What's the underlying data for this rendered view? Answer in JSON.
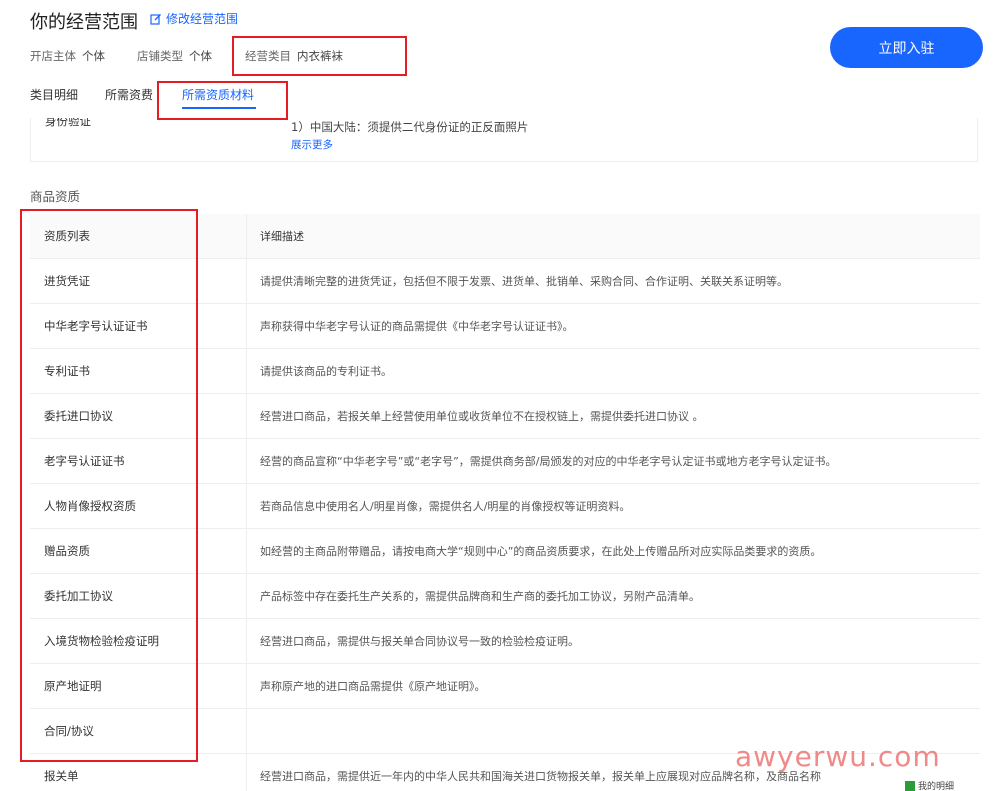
{
  "header": {
    "title": "你的经营范围",
    "edit_label": "修改经营范围",
    "shop_subject_label": "开店主体",
    "shop_subject_value": "个体",
    "shop_type_label": "店铺类型",
    "shop_type_value": "个体",
    "category_label": "经营类目",
    "category_value": "内衣裤袜",
    "cta_label": "立即入驻"
  },
  "tabs": [
    {
      "label": "类目明细"
    },
    {
      "label": "所需资费"
    },
    {
      "label": "所需资质材料",
      "active": true
    }
  ],
  "id_card": {
    "label": "身份验证",
    "text": "1）中国大陆：须提供二代身份证的正反面照片",
    "show_more": "展示更多"
  },
  "section_title": "商品资质",
  "table": {
    "headers": [
      "资质列表",
      "详细描述"
    ],
    "rows": [
      {
        "name": "进货凭证",
        "desc": "请提供清晰完整的进货凭证，包括但不限于发票、进货单、批销单、采购合同、合作证明、关联关系证明等。"
      },
      {
        "name": "中华老字号认证证书",
        "desc": "声称获得中华老字号认证的商品需提供《中华老字号认证证书》。"
      },
      {
        "name": "专利证书",
        "desc": "请提供该商品的专利证书。"
      },
      {
        "name": "委托进口协议",
        "desc": "经营进口商品，若报关单上经营使用单位或收货单位不在授权链上，需提供委托进口协议 。"
      },
      {
        "name": "老字号认证证书",
        "desc": "经营的商品宣称“中华老字号”或“老字号”，需提供商务部/局颁发的对应的中华老字号认定证书或地方老字号认定证书。"
      },
      {
        "name": "人物肖像授权资质",
        "desc": "若商品信息中使用名人/明星肖像，需提供名人/明星的肖像授权等证明资料。"
      },
      {
        "name": "赠品资质",
        "desc": "如经营的主商品附带赠品，请按电商大学“规则中心”的商品资质要求，在此处上传赠品所对应实际品类要求的资质。"
      },
      {
        "name": "委托加工协议",
        "desc": "产品标签中存在委托生产关系的，需提供品牌商和生产商的委托加工协议，另附产品清单。"
      },
      {
        "name": "入境货物检验检疫证明",
        "desc": "经营进口商品，需提供与报关单合同协议号一致的检验检疫证明。"
      },
      {
        "name": "原产地证明",
        "desc": "声称原产地的进口商品需提供《原产地证明》。"
      },
      {
        "name": "合同/协议",
        "desc": ""
      },
      {
        "name": "报关单",
        "desc": "经营进口商品，需提供近一年内的中华人民共和国海关进口货物报关单，报关单上应展现对应品牌名称，及商品名称"
      }
    ]
  },
  "watermark": "awyerwu.com",
  "corner_text": "我的明细",
  "colors": {
    "accent": "#1966ff",
    "highlight": "#e51c23"
  }
}
